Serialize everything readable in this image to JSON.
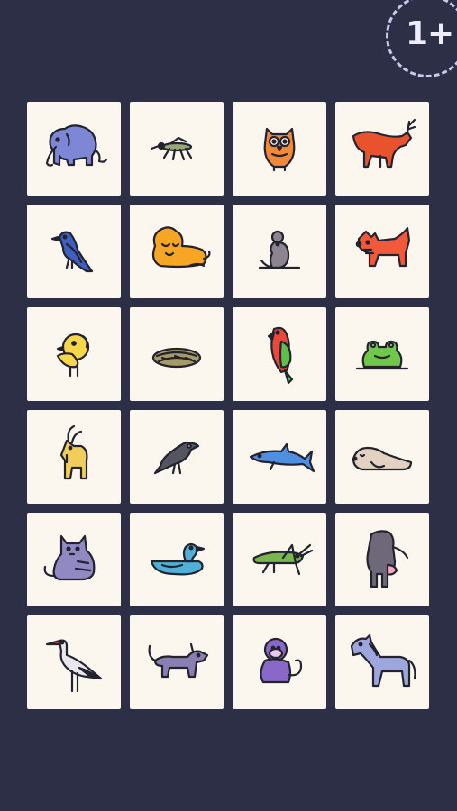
{
  "badge": {
    "label": "1+"
  },
  "tiles": [
    {
      "animal": "elephant",
      "icon": "elephant-icon",
      "color": "#7e86d6"
    },
    {
      "animal": "mosquito",
      "icon": "mosquito-icon",
      "color": "#9aa77a"
    },
    {
      "animal": "owl",
      "icon": "owl-icon",
      "color": "#f08a3a"
    },
    {
      "animal": "deer",
      "icon": "deer-icon",
      "color": "#e8532e"
    },
    {
      "animal": "bird",
      "icon": "bluebird-icon",
      "color": "#3f5fc0"
    },
    {
      "animal": "lion",
      "icon": "lion-icon",
      "color": "#f6a623"
    },
    {
      "animal": "mouse",
      "icon": "mouse-icon",
      "color": "#8c8590"
    },
    {
      "animal": "dog",
      "icon": "terrier-icon",
      "color": "#f05a3a"
    },
    {
      "animal": "chick",
      "icon": "chick-icon",
      "color": "#f7d74a"
    },
    {
      "animal": "nest",
      "icon": "nest-icon",
      "color": "#a89a68"
    },
    {
      "animal": "parrot",
      "icon": "parrot-icon",
      "color": "#e9483b"
    },
    {
      "animal": "frog",
      "icon": "frog-icon",
      "color": "#6fc84a"
    },
    {
      "animal": "goat",
      "icon": "goat-icon",
      "color": "#f1cd5a"
    },
    {
      "animal": "crow",
      "icon": "crow-icon",
      "color": "#55555f"
    },
    {
      "animal": "dolphin",
      "icon": "dolphin-icon",
      "color": "#4f8fe0"
    },
    {
      "animal": "seal",
      "icon": "seal-icon",
      "color": "#e3d2c2"
    },
    {
      "animal": "cat",
      "icon": "cat-icon",
      "color": "#9189c2"
    },
    {
      "animal": "duck",
      "icon": "duck-icon",
      "color": "#4fb0d8"
    },
    {
      "animal": "grasshopper",
      "icon": "grasshopper-icon",
      "color": "#78b84a"
    },
    {
      "animal": "cow",
      "icon": "cow-icon",
      "color": "#6f6878"
    },
    {
      "animal": "stork",
      "icon": "stork-icon",
      "color": "#e9e6ee"
    },
    {
      "animal": "dog",
      "icon": "dog-icon",
      "color": "#8a7fb0"
    },
    {
      "animal": "monkey",
      "icon": "monkey-icon",
      "color": "#8a68c8"
    },
    {
      "animal": "horse",
      "icon": "horse-icon",
      "color": "#9ea6de"
    }
  ]
}
